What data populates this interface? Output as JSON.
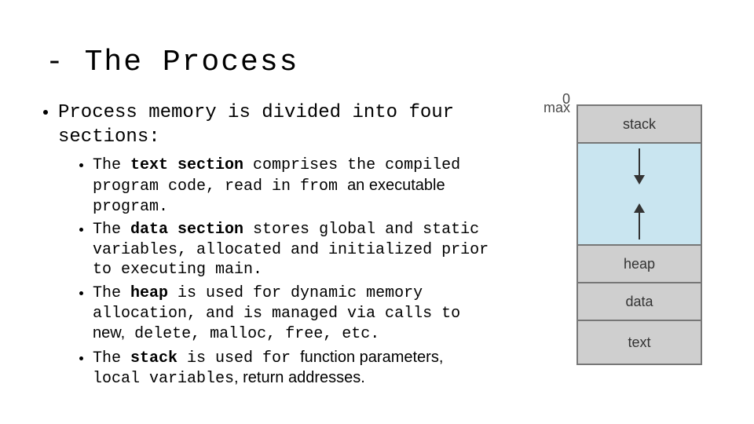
{
  "title": "- The Process",
  "intro": "Process memory is divided into four sections:",
  "bullets": {
    "b1_pre": "The ",
    "b1_bold": "text section",
    "b1_post": " comprises the compiled program code, read in from ",
    "b1_sans": "an executable",
    "b1_tail": " program.",
    "b2_pre": "The ",
    "b2_bold": "data section",
    "b2_post": " stores global and static variables, allocated and initialized prior to executing main.",
    "b3_pre": "The ",
    "b3_bold": "heap",
    "b3_post": " is used for dynamic memory allocation, and is managed via calls to ",
    "b3_sans": "new,",
    "b3_tail": " delete, malloc, free, etc.",
    "b4_pre": "The ",
    "b4_bold": "stack",
    "b4_post": " is used for ",
    "b4_sans1": "function parameters,",
    "b4_mid": " local variables",
    "b4_sans2": ", return addresses."
  },
  "diagram": {
    "max": "max",
    "zero": "0",
    "stack": "stack",
    "heap": "heap",
    "data": "data",
    "text": "text"
  }
}
